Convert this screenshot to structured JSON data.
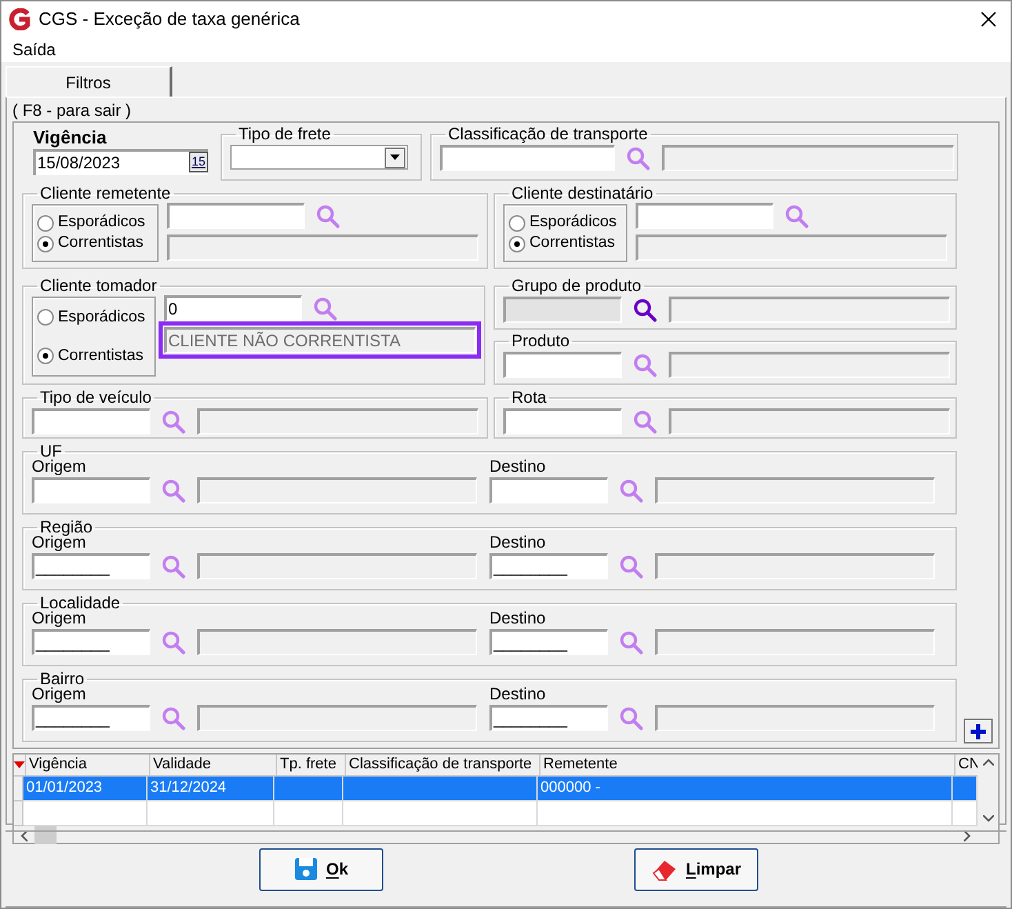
{
  "window": {
    "title": "CGS - Exceção de taxa genérica"
  },
  "menu": [
    {
      "label": "Saída"
    }
  ],
  "tabs": [
    {
      "label": "Filtros",
      "selected": true
    }
  ],
  "hint": "( F8 - para sair )",
  "vigencia": {
    "label": "Vigência",
    "value": "15/08/2023",
    "calendar_button": "15"
  },
  "tipo_de_frete": {
    "label": "Tipo de frete"
  },
  "classificacao_de_transporte": {
    "label": "Classificação de transporte"
  },
  "clients": [
    {
      "label": "Cliente remetente",
      "options": [
        {
          "label": "Esporádicos",
          "selected": false
        },
        {
          "label": "Correntistas",
          "selected": true
        }
      ],
      "highlighted": false
    },
    {
      "label": "Cliente destinatário",
      "options": [
        {
          "label": "Esporádicos",
          "selected": false
        },
        {
          "label": "Correntistas",
          "selected": true
        }
      ],
      "highlighted": false
    },
    {
      "label": "Cliente tomador",
      "code": "0",
      "name": "CLIENTE NÃO CORRENTISTA",
      "options": [
        {
          "label": "Esporádicos",
          "selected": false
        },
        {
          "label": "Correntistas",
          "selected": true
        }
      ],
      "highlighted": true
    }
  ],
  "grupo_de_produto": {
    "label": "Grupo de produto",
    "disabled": true
  },
  "produto": {
    "label": "Produto",
    "disabled": false
  },
  "tipo_de_veiculo": {
    "label": "Tipo de veículo",
    "disabled": false
  },
  "rota": {
    "label": "Rota",
    "disabled": false
  },
  "location_groups": [
    {
      "label": "UF",
      "origin_label": "Origem",
      "destination_label": "Destino"
    },
    {
      "label": "Região",
      "origin_label": "Origem",
      "destination_label": "Destino",
      "origin_value": "________",
      "destination_value": "________"
    },
    {
      "label": "Localidade",
      "origin_label": "Origem",
      "destination_label": "Destino",
      "origin_value": "________",
      "destination_value": "________"
    },
    {
      "label": "Bairro",
      "origin_label": "Origem",
      "destination_label": "Destino",
      "origin_value": "________",
      "destination_value": "________"
    }
  ],
  "table": {
    "columns": [
      "Vigência",
      "Validade",
      "Tp. frete",
      "Classificação de transporte",
      "Remetente",
      "CN"
    ],
    "rows": [
      {
        "selected": true,
        "cells": [
          "01/01/2023",
          "31/12/2024",
          null,
          null,
          "000000 -",
          null
        ]
      },
      {
        "selected": false,
        "cells": [
          null,
          null,
          null,
          null,
          null,
          null
        ]
      }
    ]
  },
  "buttons": [
    {
      "label": "Ok",
      "kind": "save"
    },
    {
      "label": "Limpar",
      "kind": "erase"
    }
  ]
}
